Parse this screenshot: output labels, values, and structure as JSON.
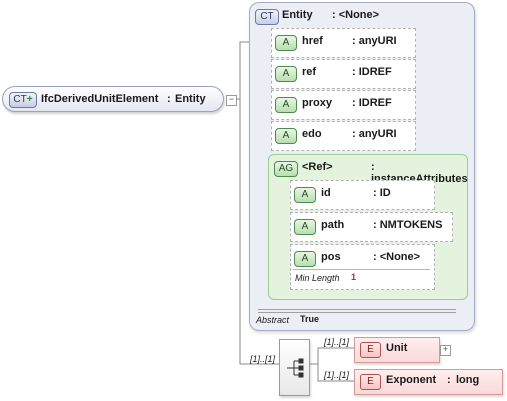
{
  "root": {
    "badge": "CT",
    "name": "IfcDerivedUnitElement",
    "separator": ":",
    "type": "Entity"
  },
  "complex_type": {
    "badge": "CT",
    "name": "Entity",
    "type_label": ": <None>",
    "attributes": [
      {
        "badge": "A",
        "name": "href",
        "type": ": anyURI"
      },
      {
        "badge": "A",
        "name": "ref",
        "type": ": IDREF"
      },
      {
        "badge": "A",
        "name": "proxy",
        "type": ": IDREF"
      },
      {
        "badge": "A",
        "name": "edo",
        "type": ": anyURI"
      }
    ],
    "attribute_group": {
      "badge": "AG",
      "name": "<Ref>",
      "type": ": instanceAttributes",
      "attributes": [
        {
          "badge": "A",
          "name": "id",
          "type": ": ID"
        },
        {
          "badge": "A",
          "name": "path",
          "type": ": NMTOKENS"
        },
        {
          "badge": "A",
          "name": "pos",
          "type": ": <None>",
          "facet_label": "Min Length",
          "facet_value": "1"
        }
      ]
    },
    "abstract_label": "Abstract",
    "abstract_value": "True"
  },
  "sequence": {
    "cardinality": "[1]..[1]",
    "elements": [
      {
        "badge": "E",
        "name": "Unit",
        "cardinality": "[1]..[1]"
      },
      {
        "badge": "E",
        "name": "Exponent",
        "separator": ":",
        "type": "long",
        "cardinality": "[1]..[1]"
      }
    ]
  },
  "colors": {
    "complex_type_border": "#a5abc4",
    "attribute_group_fill": "#e3f3dd",
    "element_fill": "#f9d9d9"
  }
}
